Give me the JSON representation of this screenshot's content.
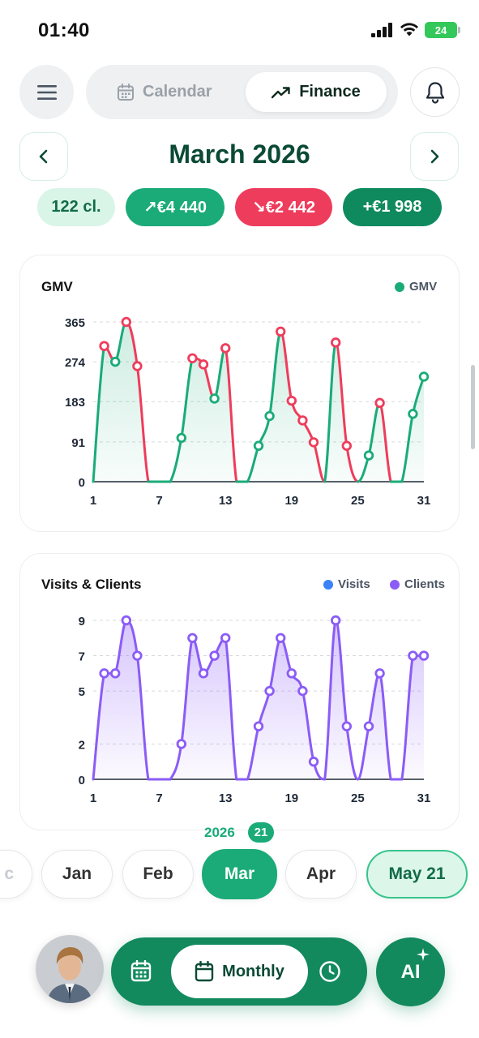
{
  "status_bar": {
    "time": "01:40",
    "battery": "24"
  },
  "top_nav": {
    "tabs": [
      {
        "label": "Calendar",
        "active": false
      },
      {
        "label": "Finance",
        "active": true
      }
    ]
  },
  "header": {
    "title": "March 2026"
  },
  "summary": {
    "clients": "122 cl.",
    "income": "↗€4 440",
    "expenses": "↘€2 442",
    "net": "+€1 998"
  },
  "colors": {
    "accent": "#1aab78",
    "accent_dark": "#0f8a5f",
    "negative": "#ee3d5c",
    "title_green": "#0b4a35",
    "visits": "#3b82f6",
    "clients": "#8b5cf6"
  },
  "chart_data": [
    {
      "type": "area",
      "title": "GMV",
      "legend": [
        {
          "name": "GMV",
          "color": "#1aab78"
        }
      ],
      "x_ticks": [
        1,
        7,
        13,
        19,
        25,
        31
      ],
      "y_ticks": [
        0,
        91,
        183,
        274,
        365
      ],
      "ylim": [
        0,
        365
      ],
      "xlim": [
        1,
        31
      ],
      "grid": true,
      "series": [
        {
          "name": "GMV",
          "x": [
            1,
            2,
            3,
            4,
            5,
            6,
            7,
            8,
            9,
            10,
            11,
            12,
            13,
            14,
            15,
            16,
            17,
            18,
            19,
            20,
            21,
            22,
            23,
            24,
            25,
            26,
            27,
            28,
            29,
            30,
            31
          ],
          "values": [
            0,
            310,
            274,
            365,
            264,
            0,
            0,
            0,
            100,
            282,
            268,
            190,
            305,
            0,
            0,
            82,
            150,
            343,
            185,
            140,
            90,
            0,
            318,
            82,
            0,
            60,
            180,
            0,
            0,
            155,
            240
          ]
        }
      ]
    },
    {
      "type": "area",
      "title": "Visits & Clients",
      "legend": [
        {
          "name": "Visits",
          "color": "#3b82f6"
        },
        {
          "name": "Clients",
          "color": "#8b5cf6"
        }
      ],
      "x_ticks": [
        1,
        7,
        13,
        19,
        25,
        31
      ],
      "y_ticks": [
        0,
        2,
        5,
        7,
        9
      ],
      "ylim": [
        0,
        9
      ],
      "xlim": [
        1,
        31
      ],
      "grid": true,
      "series": [
        {
          "name": "Clients",
          "x": [
            1,
            2,
            3,
            4,
            5,
            6,
            7,
            8,
            9,
            10,
            11,
            12,
            13,
            14,
            15,
            16,
            17,
            18,
            19,
            20,
            21,
            22,
            23,
            24,
            25,
            26,
            27,
            28,
            29,
            30,
            31
          ],
          "values": [
            0,
            6,
            6,
            9,
            7,
            0,
            0,
            0,
            2,
            8,
            6,
            7,
            8,
            0,
            0,
            3,
            5,
            8,
            6,
            5,
            1,
            0,
            9,
            3,
            0,
            3,
            6,
            0,
            0,
            7,
            7
          ]
        }
      ]
    }
  ],
  "month_selector": {
    "year": "2026",
    "badge": "21",
    "months": [
      {
        "label": "c",
        "state": "ghost"
      },
      {
        "label": "Jan",
        "state": "normal"
      },
      {
        "label": "Feb",
        "state": "normal"
      },
      {
        "label": "Mar",
        "state": "selected"
      },
      {
        "label": "Apr",
        "state": "normal"
      },
      {
        "label": "May 21",
        "state": "highlight"
      }
    ]
  },
  "bottom_bar": {
    "view_label": "Monthly",
    "ai_label": "AI"
  }
}
